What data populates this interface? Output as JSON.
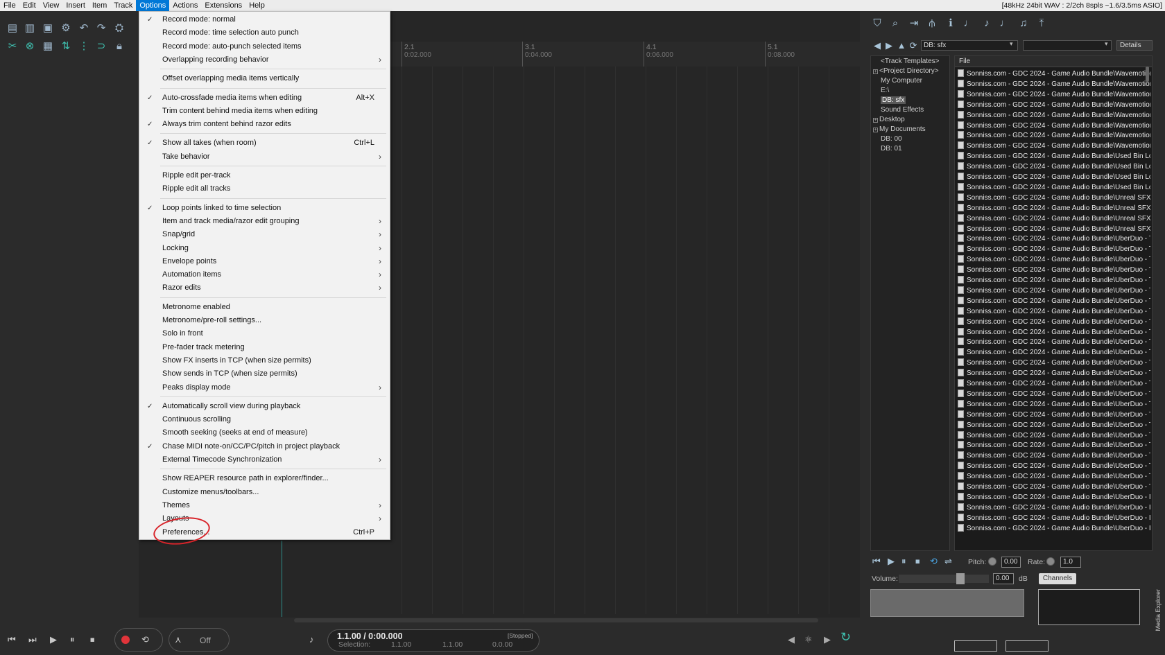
{
  "menubar": {
    "items": [
      "File",
      "Edit",
      "View",
      "Insert",
      "Item",
      "Track",
      "Options",
      "Actions",
      "Extensions",
      "Help"
    ],
    "active": "Options",
    "status": "[48kHz 24bit WAV : 2/2ch 8spls ~1.6/3.5ms ASIO]"
  },
  "ruler": {
    "marks": [
      {
        "bar": "2.1",
        "time": "0:02.000"
      },
      {
        "bar": "3.1",
        "time": "0:04.000"
      },
      {
        "bar": "4.1",
        "time": "0:06.000"
      },
      {
        "bar": "5.1",
        "time": "0:08.000"
      }
    ]
  },
  "options_menu": {
    "items": [
      {
        "label": "Record mode: normal",
        "checked": true,
        "shortcut": "",
        "submenu": false
      },
      {
        "label": "Record mode: time selection auto punch",
        "checked": false,
        "shortcut": "",
        "submenu": false
      },
      {
        "label": "Record mode: auto-punch selected items",
        "checked": false,
        "shortcut": "",
        "submenu": false
      },
      {
        "label": "Overlapping recording behavior",
        "checked": false,
        "shortcut": "",
        "submenu": true
      },
      {
        "separator": true
      },
      {
        "label": "Offset overlapping media items vertically",
        "checked": false,
        "shortcut": "",
        "submenu": false
      },
      {
        "separator": true
      },
      {
        "label": "Auto-crossfade media items when editing",
        "checked": true,
        "shortcut": "Alt+X",
        "submenu": false
      },
      {
        "label": "Trim content behind media items when editing",
        "checked": false,
        "shortcut": "",
        "submenu": false
      },
      {
        "label": "Always trim content behind razor edits",
        "checked": true,
        "shortcut": "",
        "submenu": false
      },
      {
        "separator": true
      },
      {
        "label": "Show all takes (when room)",
        "checked": true,
        "shortcut": "Ctrl+L",
        "submenu": false
      },
      {
        "label": "Take behavior",
        "checked": false,
        "shortcut": "",
        "submenu": true
      },
      {
        "separator": true
      },
      {
        "label": "Ripple edit per-track",
        "checked": false,
        "shortcut": "",
        "submenu": false
      },
      {
        "label": "Ripple edit all tracks",
        "checked": false,
        "shortcut": "",
        "submenu": false
      },
      {
        "separator": true
      },
      {
        "label": "Loop points linked to time selection",
        "checked": true,
        "shortcut": "",
        "submenu": false
      },
      {
        "label": "Item and track media/razor edit grouping",
        "checked": false,
        "shortcut": "",
        "submenu": true
      },
      {
        "label": "Snap/grid",
        "checked": false,
        "shortcut": "",
        "submenu": true
      },
      {
        "label": "Locking",
        "checked": false,
        "shortcut": "",
        "submenu": true
      },
      {
        "label": "Envelope points",
        "checked": false,
        "shortcut": "",
        "submenu": true
      },
      {
        "label": "Automation items",
        "checked": false,
        "shortcut": "",
        "submenu": true
      },
      {
        "label": "Razor edits",
        "checked": false,
        "shortcut": "",
        "submenu": true
      },
      {
        "separator": true
      },
      {
        "label": "Metronome enabled",
        "checked": false,
        "shortcut": "",
        "submenu": false
      },
      {
        "label": "Metronome/pre-roll settings...",
        "checked": false,
        "shortcut": "",
        "submenu": false
      },
      {
        "label": "Solo in front",
        "checked": false,
        "shortcut": "",
        "submenu": false
      },
      {
        "label": "Pre-fader track metering",
        "checked": false,
        "shortcut": "",
        "submenu": false
      },
      {
        "label": "Show FX inserts in TCP (when size permits)",
        "checked": false,
        "shortcut": "",
        "submenu": false
      },
      {
        "label": "Show sends in TCP (when size permits)",
        "checked": false,
        "shortcut": "",
        "submenu": false
      },
      {
        "label": "Peaks display mode",
        "checked": false,
        "shortcut": "",
        "submenu": true
      },
      {
        "separator": true
      },
      {
        "label": "Automatically scroll view during playback",
        "checked": true,
        "shortcut": "",
        "submenu": false
      },
      {
        "label": "Continuous scrolling",
        "checked": false,
        "shortcut": "",
        "submenu": false
      },
      {
        "label": "Smooth seeking (seeks at end of measure)",
        "checked": false,
        "shortcut": "",
        "submenu": false
      },
      {
        "label": "Chase MIDI note-on/CC/PC/pitch in project playback",
        "checked": true,
        "shortcut": "",
        "submenu": false
      },
      {
        "label": "External Timecode Synchronization",
        "checked": false,
        "shortcut": "",
        "submenu": true
      },
      {
        "separator": true
      },
      {
        "label": "Show REAPER resource path in explorer/finder...",
        "checked": false,
        "shortcut": "",
        "submenu": false
      },
      {
        "label": "Customize menus/toolbars...",
        "checked": false,
        "shortcut": "",
        "submenu": false
      },
      {
        "label": "Themes",
        "checked": false,
        "shortcut": "",
        "submenu": true
      },
      {
        "label": "Layouts",
        "checked": false,
        "shortcut": "",
        "submenu": true
      },
      {
        "label": "Preferences...",
        "checked": false,
        "shortcut": "Ctrl+P",
        "submenu": false
      }
    ],
    "check_glyph": "✓",
    "arrow_glyph": "›"
  },
  "media_explorer": {
    "path_value": "DB: sfx",
    "search_value": "",
    "view_mode": "Details",
    "tree": [
      {
        "label": "<Track Templates>",
        "expander": false,
        "selected": false,
        "indent": 1
      },
      {
        "label": "<Project Directory>",
        "expander": true,
        "selected": false,
        "indent": 0
      },
      {
        "label": "My Computer",
        "expander": false,
        "selected": false,
        "indent": 1
      },
      {
        "label": "E:\\",
        "expander": false,
        "selected": false,
        "indent": 1
      },
      {
        "label": "DB: sfx",
        "expander": false,
        "selected": true,
        "indent": 1
      },
      {
        "label": "Sound Effects",
        "expander": false,
        "selected": false,
        "indent": 1
      },
      {
        "label": "Desktop",
        "expander": true,
        "selected": false,
        "indent": 0
      },
      {
        "label": "My Documents",
        "expander": true,
        "selected": false,
        "indent": 0
      },
      {
        "label": "DB: 00",
        "expander": false,
        "selected": false,
        "indent": 1
      },
      {
        "label": "DB: 01",
        "expander": false,
        "selected": false,
        "indent": 1
      }
    ],
    "file_column_header": "File",
    "files": [
      "Sonniss.com - GDC 2024 - Game Audio Bundle\\Wavemotion",
      "Sonniss.com - GDC 2024 - Game Audio Bundle\\Wavemotion",
      "Sonniss.com - GDC 2024 - Game Audio Bundle\\Wavemotion",
      "Sonniss.com - GDC 2024 - Game Audio Bundle\\Wavemotion",
      "Sonniss.com - GDC 2024 - Game Audio Bundle\\Wavemotion",
      "Sonniss.com - GDC 2024 - Game Audio Bundle\\Wavemotion",
      "Sonniss.com - GDC 2024 - Game Audio Bundle\\Wavemotion",
      "Sonniss.com - GDC 2024 - Game Audio Bundle\\Wavemotion",
      "Sonniss.com - GDC 2024 - Game Audio Bundle\\Used Bin Lo",
      "Sonniss.com - GDC 2024 - Game Audio Bundle\\Used Bin Lo",
      "Sonniss.com - GDC 2024 - Game Audio Bundle\\Used Bin Lo",
      "Sonniss.com - GDC 2024 - Game Audio Bundle\\Used Bin Lo",
      "Sonniss.com - GDC 2024 - Game Audio Bundle\\Unreal SFX",
      "Sonniss.com - GDC 2024 - Game Audio Bundle\\Unreal SFX",
      "Sonniss.com - GDC 2024 - Game Audio Bundle\\Unreal SFX",
      "Sonniss.com - GDC 2024 - Game Audio Bundle\\Unreal SFX",
      "Sonniss.com - GDC 2024 - Game Audio Bundle\\UberDuo - T",
      "Sonniss.com - GDC 2024 - Game Audio Bundle\\UberDuo - T",
      "Sonniss.com - GDC 2024 - Game Audio Bundle\\UberDuo - T",
      "Sonniss.com - GDC 2024 - Game Audio Bundle\\UberDuo - T",
      "Sonniss.com - GDC 2024 - Game Audio Bundle\\UberDuo - T",
      "Sonniss.com - GDC 2024 - Game Audio Bundle\\UberDuo - T",
      "Sonniss.com - GDC 2024 - Game Audio Bundle\\UberDuo - T",
      "Sonniss.com - GDC 2024 - Game Audio Bundle\\UberDuo - T",
      "Sonniss.com - GDC 2024 - Game Audio Bundle\\UberDuo - T",
      "Sonniss.com - GDC 2024 - Game Audio Bundle\\UberDuo - T",
      "Sonniss.com - GDC 2024 - Game Audio Bundle\\UberDuo - T",
      "Sonniss.com - GDC 2024 - Game Audio Bundle\\UberDuo - T",
      "Sonniss.com - GDC 2024 - Game Audio Bundle\\UberDuo - T",
      "Sonniss.com - GDC 2024 - Game Audio Bundle\\UberDuo - T",
      "Sonniss.com - GDC 2024 - Game Audio Bundle\\UberDuo - T",
      "Sonniss.com - GDC 2024 - Game Audio Bundle\\UberDuo - T",
      "Sonniss.com - GDC 2024 - Game Audio Bundle\\UberDuo - T",
      "Sonniss.com - GDC 2024 - Game Audio Bundle\\UberDuo - T",
      "Sonniss.com - GDC 2024 - Game Audio Bundle\\UberDuo - T",
      "Sonniss.com - GDC 2024 - Game Audio Bundle\\UberDuo - T",
      "Sonniss.com - GDC 2024 - Game Audio Bundle\\UberDuo - T",
      "Sonniss.com - GDC 2024 - Game Audio Bundle\\UberDuo - T",
      "Sonniss.com - GDC 2024 - Game Audio Bundle\\UberDuo - T",
      "Sonniss.com - GDC 2024 - Game Audio Bundle\\UberDuo - T",
      "Sonniss.com - GDC 2024 - Game Audio Bundle\\UberDuo - T",
      "Sonniss.com - GDC 2024 - Game Audio Bundle\\UberDuo - In",
      "Sonniss.com - GDC 2024 - Game Audio Bundle\\UberDuo - In",
      "Sonniss.com - GDC 2024 - Game Audio Bundle\\UberDuo - In",
      "Sonniss.com - GDC 2024 - Game Audio Bundle\\UberDuo - In"
    ],
    "pitch_label": "Pitch:",
    "pitch_value": "0.00",
    "rate_label": "Rate:",
    "rate_value": "1.0",
    "volume_label": "Volume:",
    "volume_value": "0.00",
    "volume_unit": "dB",
    "volume_level": 0.64,
    "channels_label": "Channels",
    "side_label": "Media Explorer"
  },
  "transport": {
    "position": "1.1.00 / 0:00.000",
    "state": "[Stopped]",
    "selection_label": "Selection:",
    "selection_start": "1.1.00",
    "selection_end": "1.1.00",
    "selection_length": "0.0.00",
    "grid_label": "Off"
  },
  "colors": {
    "accent": "#0078d7",
    "record": "#e0343a",
    "annotation": "#d8242a",
    "cursor": "#2e8f8a"
  }
}
